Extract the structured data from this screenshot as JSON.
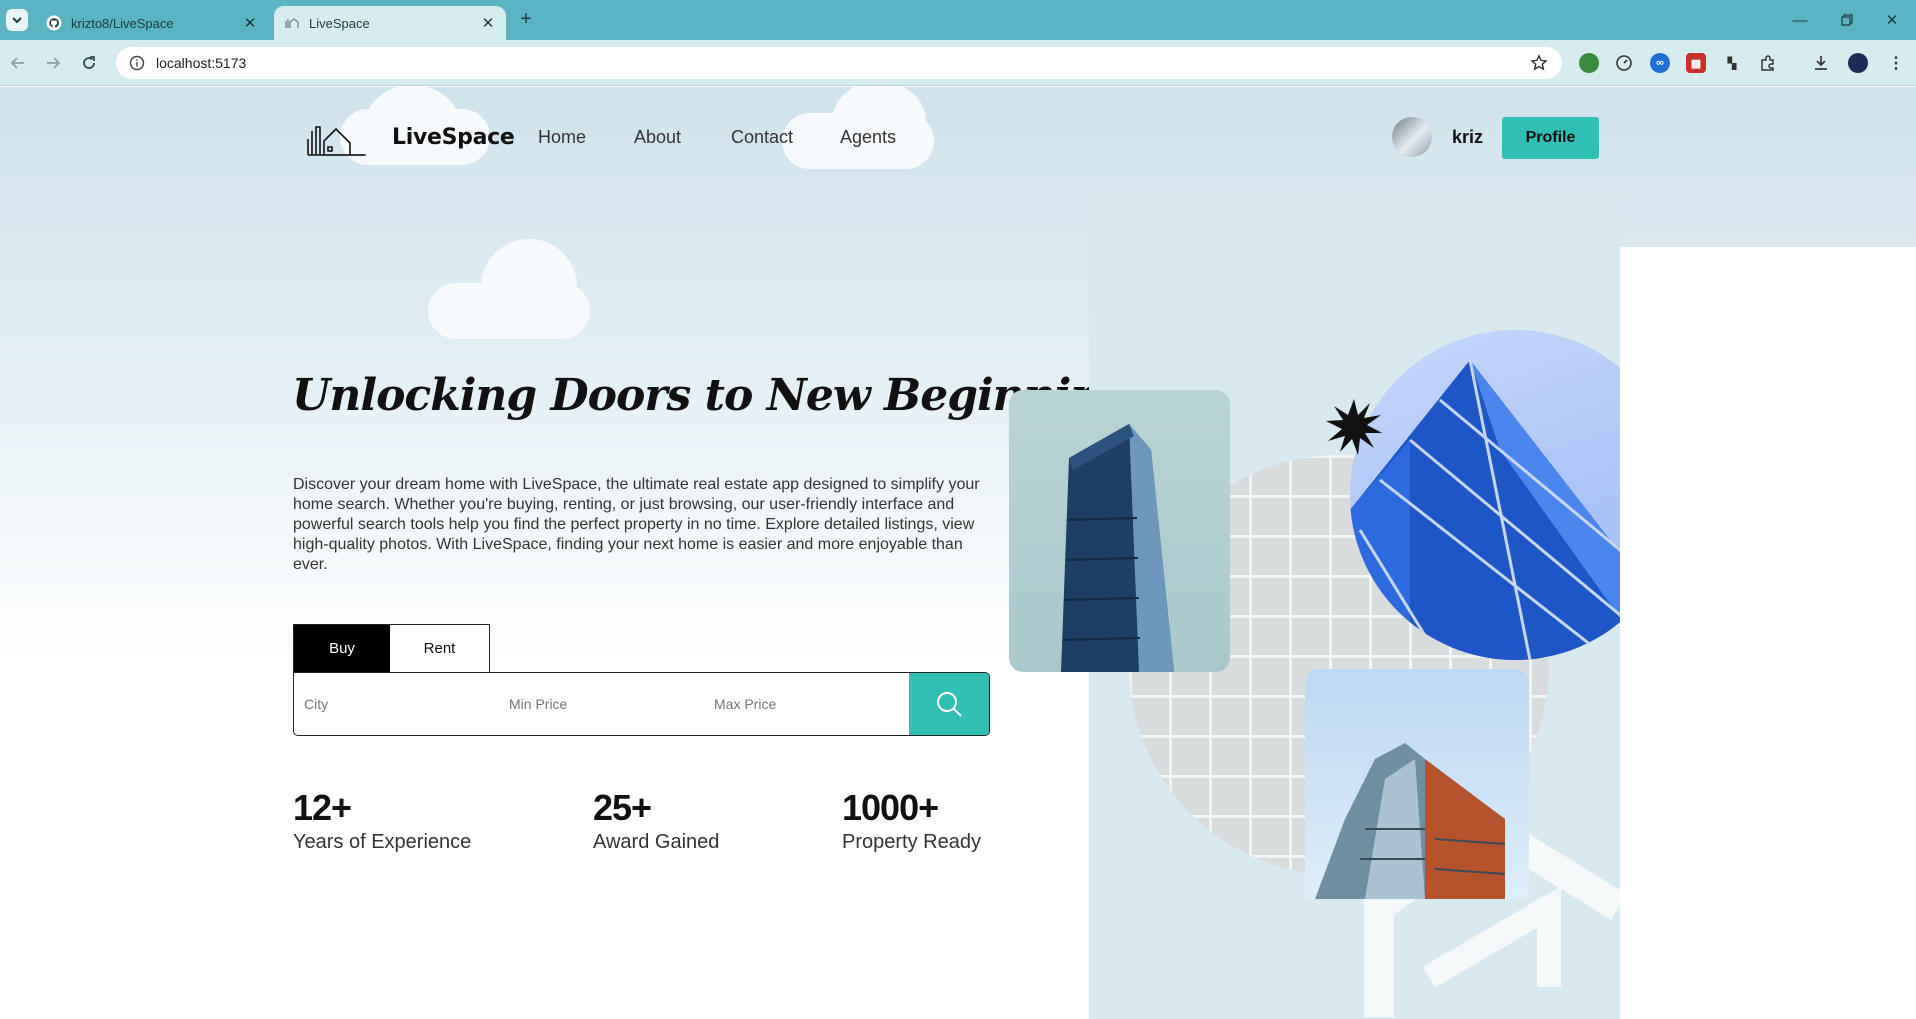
{
  "browser": {
    "tabs": [
      {
        "title": "krizto8/LiveSpace",
        "icon": "github-icon",
        "active": false
      },
      {
        "title": "LiveSpace",
        "icon": "livespace-favicon",
        "active": true
      }
    ],
    "url": "localhost:5173"
  },
  "site": {
    "brand": "LiveSpace",
    "nav": [
      "Home",
      "About",
      "Contact",
      "Agents"
    ],
    "user": {
      "name": "kriz"
    },
    "profile_label": "Profile"
  },
  "hero": {
    "headline": "Unlocking Doors to New Beginnings!",
    "description": "Discover your dream home with LiveSpace, the ultimate real estate app designed to simplify your home search. Whether you're buying, renting, or just browsing, our user-friendly interface and powerful search tools help you find the perfect property in no time. Explore detailed listings, view high-quality photos. With LiveSpace, finding your next home is easier and more enjoyable than ever."
  },
  "search": {
    "tabs": [
      "Buy",
      "Rent"
    ],
    "active_tab": "Buy",
    "fields": [
      {
        "placeholder": "City"
      },
      {
        "placeholder": "Min Price"
      },
      {
        "placeholder": "Max Price"
      }
    ]
  },
  "stats": [
    {
      "value": "12+",
      "label": "Years of Experience"
    },
    {
      "value": "25+",
      "label": "Award Gained"
    },
    {
      "value": "1000+",
      "label": "Property Ready"
    }
  ],
  "colors": {
    "accent": "#2fbfb4",
    "tabbar": "#5bb4c4",
    "toolbar": "#d6ecef"
  }
}
